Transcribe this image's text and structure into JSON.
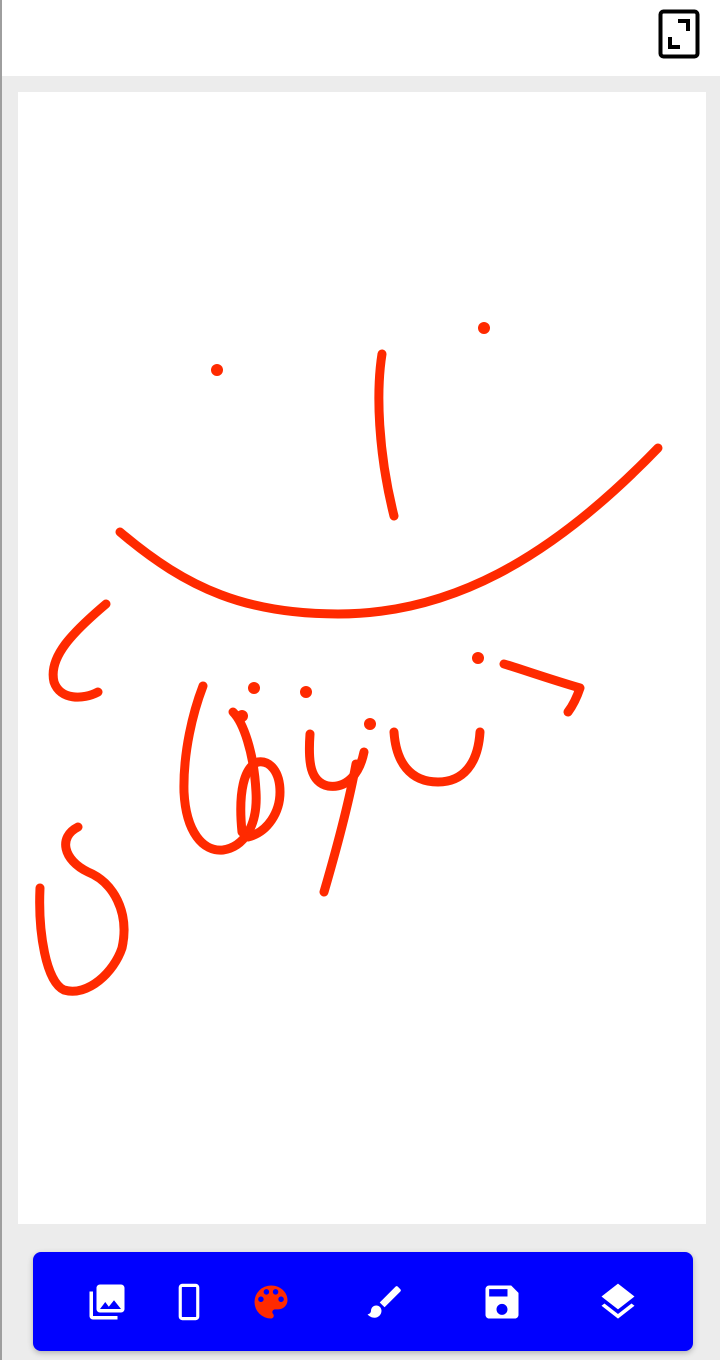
{
  "top_bar": {
    "fullscreen_icon": "fullscreen-icon"
  },
  "canvas": {
    "stroke_color": "#ff2a00",
    "background": "#ffffff"
  },
  "toolbar": {
    "background": "#0000ff",
    "tools": [
      {
        "id": "gallery",
        "icon": "image-gallery-icon",
        "color": "#ffffff"
      },
      {
        "id": "orientation",
        "icon": "phone-portrait-icon",
        "color": "#ffffff"
      },
      {
        "id": "palette",
        "icon": "palette-icon",
        "color": "#ff2a00",
        "active": true
      },
      {
        "id": "brush",
        "icon": "brush-icon",
        "color": "#ffffff"
      },
      {
        "id": "save",
        "icon": "save-icon",
        "color": "#ffffff"
      },
      {
        "id": "layers",
        "icon": "layers-icon",
        "color": "#ffffff"
      }
    ]
  }
}
